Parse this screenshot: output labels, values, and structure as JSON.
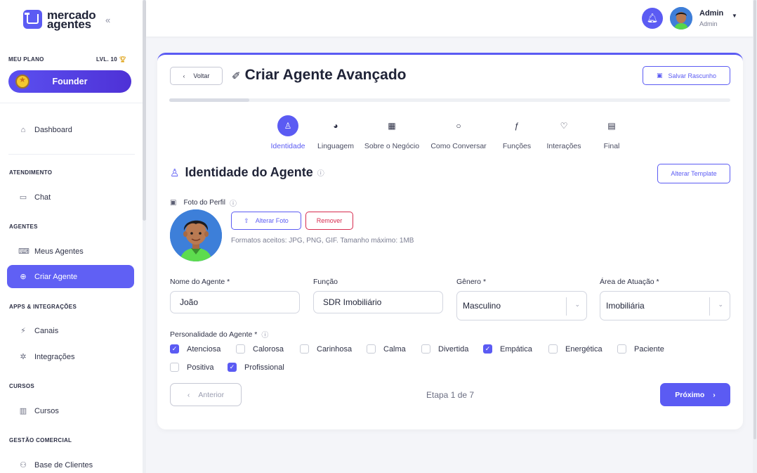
{
  "brand": {
    "line1": "mercado",
    "line2": "agentes",
    "logo_badge": "AI",
    "accent": "#5b5bf3"
  },
  "plan": {
    "label": "MEU PLANO",
    "level": "LVL. 10",
    "tier": "Founder"
  },
  "nav": {
    "dashboard": "Dashboard",
    "sections": {
      "atendimento": "ATENDIMENTO",
      "agentes": "AGENTES",
      "apps": "APPS & INTEGRAÇÕES",
      "cursos": "CURSOS",
      "gestao": "GESTÃO COMERCIAL"
    },
    "chat": "Chat",
    "meus_agentes": "Meus Agentes",
    "criar_agente": "Criar Agente",
    "canais": "Canais",
    "integracoes": "Integrações",
    "cursos": "Cursos",
    "base_clientes": "Base de Clientes"
  },
  "user": {
    "name": "Admin",
    "role": "Admin"
  },
  "page": {
    "back": "Voltar",
    "title": "Criar Agente Avançado",
    "save_draft": "Salvar Rascunho",
    "progress_fraction": 0.143
  },
  "steps": [
    {
      "label": "Identidade",
      "icon": "user-icon",
      "glyph": "♙",
      "active": true
    },
    {
      "label": "Linguagem",
      "icon": "palette-icon",
      "glyph": "◕",
      "active": false
    },
    {
      "label": "Sobre o Negócio",
      "icon": "building-icon",
      "glyph": "▦",
      "active": false
    },
    {
      "label": "Como Conversar",
      "icon": "chat-bubble-icon",
      "glyph": "○",
      "active": false
    },
    {
      "label": "Funções",
      "icon": "function-icon",
      "glyph": "ƒ",
      "active": false
    },
    {
      "label": "Interações",
      "icon": "heart-icon",
      "glyph": "♡",
      "active": false
    },
    {
      "label": "Final",
      "icon": "document-icon",
      "glyph": "▤",
      "active": false
    }
  ],
  "identity": {
    "title": "Identidade do Agente",
    "change_template": "Alterar Template",
    "photo_label": "Foto do Perfil",
    "change_photo": "Alterar Foto",
    "remove": "Remover",
    "formats": "Formatos aceitos: JPG, PNG, GIF. Tamanho máximo: 1MB"
  },
  "fields": {
    "name_label": "Nome do Agente *",
    "name_value": "João",
    "function_label": "Função",
    "function_value": "SDR Imobiliário",
    "gender_label": "Gênero *",
    "gender_value": "Masculino",
    "area_label": "Área de Atuação *",
    "area_value": "Imobiliária"
  },
  "personality": {
    "label": "Personalidade do Agente *",
    "options": [
      {
        "label": "Atenciosa",
        "checked": true
      },
      {
        "label": "Calorosa",
        "checked": false
      },
      {
        "label": "Carinhosa",
        "checked": false
      },
      {
        "label": "Calma",
        "checked": false
      },
      {
        "label": "Divertida",
        "checked": false
      },
      {
        "label": "Empática",
        "checked": true
      },
      {
        "label": "Energética",
        "checked": false
      },
      {
        "label": "Paciente",
        "checked": false
      },
      {
        "label": "Positiva",
        "checked": false
      },
      {
        "label": "Profissional",
        "checked": true
      }
    ]
  },
  "footer": {
    "prev": "Anterior",
    "step_text": "Etapa 1 de 7",
    "next": "Próximo"
  }
}
